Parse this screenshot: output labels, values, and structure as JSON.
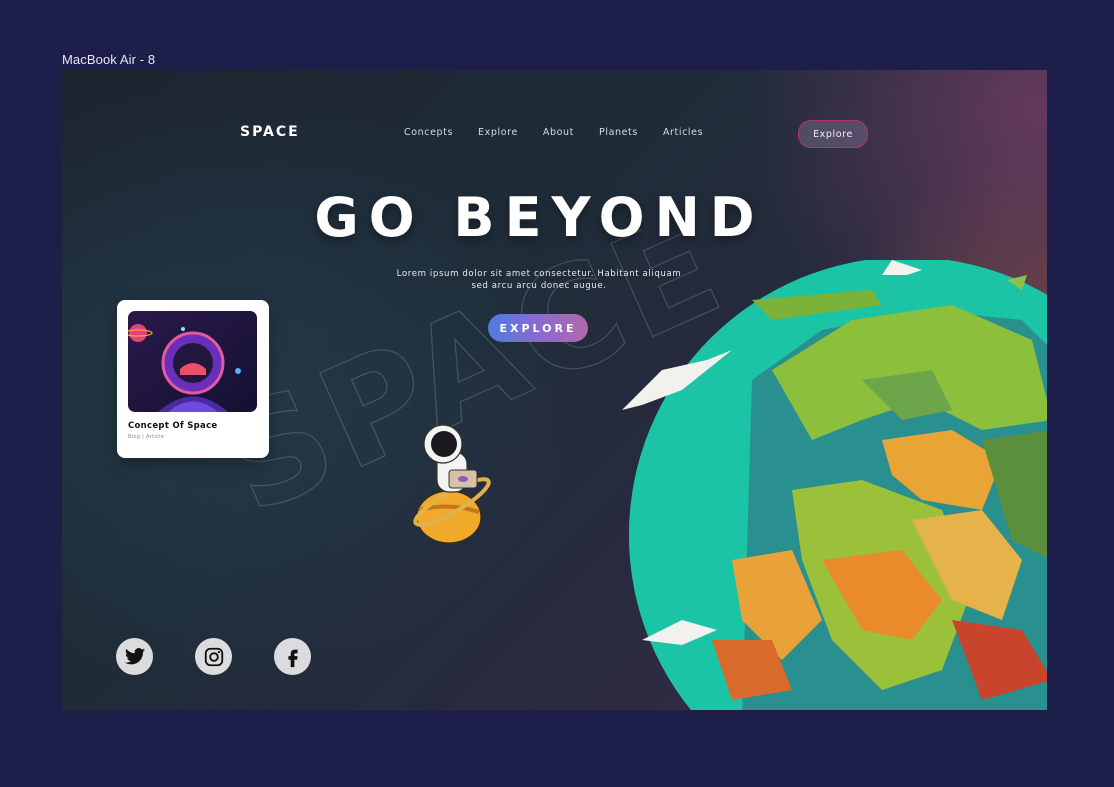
{
  "frame_label": "MacBook Air - 8",
  "header": {
    "brand": "SPACE",
    "nav": [
      "Concepts",
      "Explore",
      "About",
      "Planets",
      "Articles"
    ],
    "cta": "Explore"
  },
  "hero": {
    "title": "GO BEYOND",
    "subtitle_line1": "Lorem ipsum dolor sit amet consectetur. Habitant aliquam",
    "subtitle_line2": "sed arcu arcu donec augue.",
    "cta": "EXPLORE",
    "watermark": "SPACE"
  },
  "card": {
    "title": "Concept Of Space",
    "meta": "Blog | Article"
  },
  "social": [
    {
      "name": "twitter-icon"
    },
    {
      "name": "instagram-icon"
    },
    {
      "name": "facebook-icon"
    }
  ],
  "colors": {
    "accent_gradient_start": "#4e7be0",
    "accent_gradient_end": "#b06aa8",
    "cta_border": "#b0356f"
  }
}
